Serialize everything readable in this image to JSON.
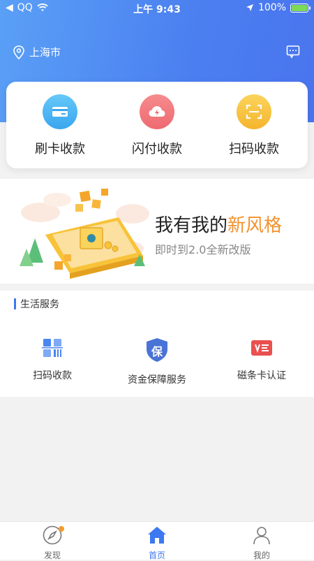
{
  "status_bar": {
    "carrier": "QQ",
    "time": "上午 9:43",
    "battery": "100%",
    "battery_level": 1.0
  },
  "header": {
    "location": "上海市",
    "icons": {
      "location": "location-pin-icon",
      "message": "message-icon"
    }
  },
  "quick_actions": [
    {
      "label": "刷卡收款",
      "icon": "card-icon",
      "color": "#4fb8f3"
    },
    {
      "label": "闪付收款",
      "icon": "cloud-icon",
      "color": "#f2787d"
    },
    {
      "label": "扫码收款",
      "icon": "scan-icon",
      "color": "#f7c242"
    }
  ],
  "banner": {
    "title_prefix": "我有我的",
    "title_highlight": "新风格",
    "subtitle": "即时到2.0全新改版"
  },
  "services": {
    "title": "生活服务",
    "items": [
      {
        "label": "扫码收款",
        "icon": "qr-code-icon"
      },
      {
        "label": "资金保障服务",
        "icon": "shield-icon",
        "badge_text": "保"
      },
      {
        "label": "磁条卡认证",
        "icon": "card-verify-icon"
      }
    ]
  },
  "tabbar": {
    "tabs": [
      {
        "label": "发现",
        "icon": "compass-icon",
        "active": false,
        "badge": true
      },
      {
        "label": "首页",
        "icon": "home-icon",
        "active": true,
        "badge": false
      },
      {
        "label": "我的",
        "icon": "user-icon",
        "active": false,
        "badge": false
      }
    ]
  },
  "colors": {
    "primary": "#3c78f0",
    "highlight": "#f3912e"
  }
}
